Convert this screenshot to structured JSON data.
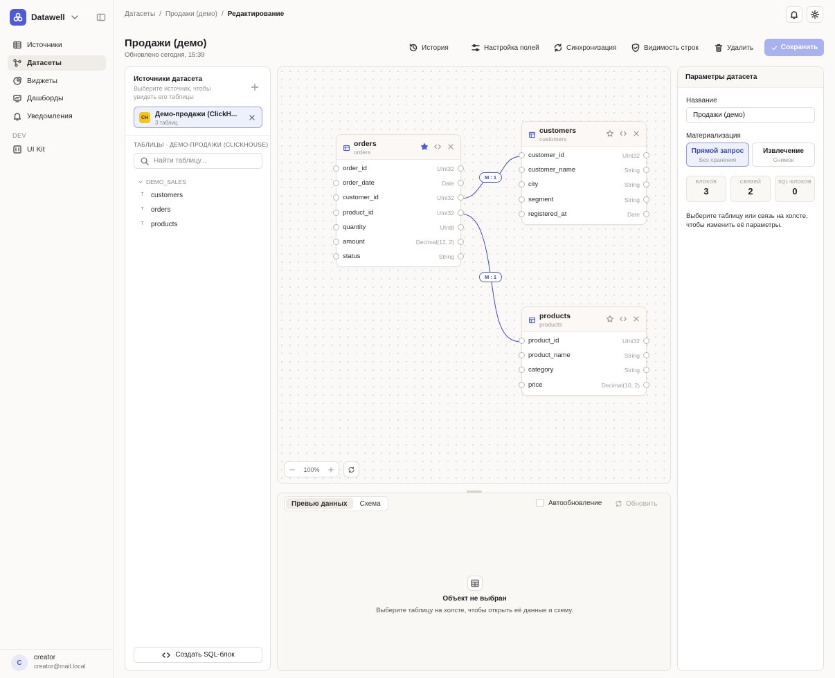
{
  "app": {
    "name": "Datawell"
  },
  "sidebar": {
    "items": [
      {
        "label": "Источники",
        "icon": "table-icon"
      },
      {
        "label": "Датасеты",
        "icon": "dataset-icon",
        "active": true
      },
      {
        "label": "Виджеты",
        "icon": "pie-chart-icon"
      },
      {
        "label": "Дашборды",
        "icon": "dashboard-icon"
      },
      {
        "label": "Уведомления",
        "icon": "bell-icon"
      }
    ],
    "dev_label": "DEV",
    "dev_items": [
      {
        "label": "UI Kit",
        "icon": "ui-kit-icon"
      }
    ]
  },
  "user": {
    "initial": "C",
    "name": "creator",
    "email": "creator@mail.local"
  },
  "breadcrumb": {
    "items": [
      "Датасеты",
      "Продажи (демо)"
    ],
    "current": "Редактирование",
    "separator": "/"
  },
  "header": {
    "title": "Продажи (демо)",
    "subtitle": "Обновлено сегодня, 15:39",
    "toolbar": {
      "history": "История",
      "fields": "Настройка полей",
      "sync": "Синхронизация",
      "row_visibility": "Видимость строк",
      "delete": "Удалить",
      "save": "Сохранить"
    }
  },
  "sources_panel": {
    "title": "Источники датасета",
    "hint": "Выберите источник, чтобы увидеть его таблицы",
    "source": {
      "badge": "CH",
      "name": "Демо-продажи (ClickH...",
      "count": "3 таблиц"
    },
    "tables_label": "ТАБЛИЦЫ · ДЕМО-ПРОДАЖИ (CLICKHOUSE)",
    "search_placeholder": "Найти таблицу...",
    "schema": "DEMO_SALES",
    "tables": [
      "customers",
      "orders",
      "products"
    ],
    "sql_button": "Создать SQL-блок"
  },
  "canvas": {
    "zoom": "100%",
    "tables": [
      {
        "name": "orders",
        "sub": "orders",
        "starred": true,
        "fields": [
          {
            "name": "order_id",
            "type": "UInt32"
          },
          {
            "name": "order_date",
            "type": "Date"
          },
          {
            "name": "customer_id",
            "type": "UInt32"
          },
          {
            "name": "product_id",
            "type": "UInt32"
          },
          {
            "name": "quantity",
            "type": "UInt8"
          },
          {
            "name": "amount",
            "type": "Decimal(12, 2)"
          },
          {
            "name": "status",
            "type": "String"
          }
        ]
      },
      {
        "name": "customers",
        "sub": "customers",
        "starred": false,
        "fields": [
          {
            "name": "customer_id",
            "type": "UInt32"
          },
          {
            "name": "customer_name",
            "type": "String"
          },
          {
            "name": "city",
            "type": "String"
          },
          {
            "name": "segment",
            "type": "String"
          },
          {
            "name": "registered_at",
            "type": "Date"
          }
        ]
      },
      {
        "name": "products",
        "sub": "products",
        "starred": false,
        "fields": [
          {
            "name": "product_id",
            "type": "UInt32"
          },
          {
            "name": "product_name",
            "type": "String"
          },
          {
            "name": "category",
            "type": "String"
          },
          {
            "name": "price",
            "type": "Decimal(10, 2)"
          }
        ]
      }
    ],
    "relations": [
      {
        "from": "orders.customer_id",
        "to": "customers.customer_id",
        "label": "M : 1"
      },
      {
        "from": "orders.product_id",
        "to": "products.product_id",
        "label": "M : 1"
      }
    ],
    "edge_color": "#3d49b8"
  },
  "preview": {
    "tabs": [
      "Превью данных",
      "Схема"
    ],
    "autorefresh": "Автообновление",
    "refresh": "Обновить",
    "empty_title": "Объект не выбран",
    "empty_text": "Выберите таблицу на холсте, чтобы открыть её данные и схему."
  },
  "params": {
    "title": "Параметры датасета",
    "name_label": "Название",
    "name_value": "Продажи (демо)",
    "mat_label": "Материализация",
    "mat_options": [
      {
        "title": "Прямой запрос",
        "sub": "Без хранения",
        "active": true
      },
      {
        "title": "Извлечение",
        "sub": "Снимок",
        "active": false
      }
    ],
    "stats": [
      {
        "label": "БЛОКОВ",
        "value": "3"
      },
      {
        "label": "СВЯЗЕЙ",
        "value": "2"
      },
      {
        "label": "SQL-БЛОКОВ",
        "value": "0"
      }
    ],
    "hint": "Выберите таблицу или связь на холсте, чтобы изменить её параметры."
  },
  "colors": {
    "accent": "#4f5bd5",
    "accent_light": "#eef0fb",
    "save_disabled": "#a9b1ee"
  }
}
